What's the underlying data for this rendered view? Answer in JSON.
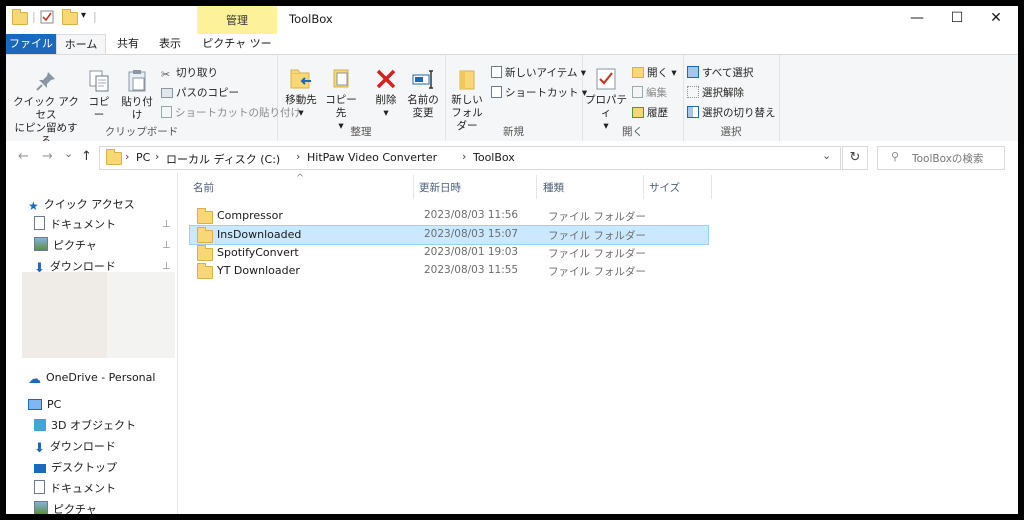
{
  "window": {
    "title": "ToolBox",
    "context_tab_group": "管理",
    "minimize": "—",
    "maximize": "☐",
    "close": "✕"
  },
  "ribbon_tabs": {
    "file": "ファイル",
    "home": "ホーム",
    "share": "共有",
    "view": "表示",
    "picture_tools": "ピクチャ ツール",
    "help": "?",
    "collapse": "⌃"
  },
  "ribbon": {
    "clipboard": {
      "label": "クリップボード",
      "pin_quick_access": [
        "クイック アクセス",
        "にピン留めする"
      ],
      "copy": "コピー",
      "paste": "貼り付け",
      "cut": "切り取り",
      "copy_path": "パスのコピー",
      "paste_shortcut": "ショートカットの貼り付け"
    },
    "organize": {
      "label": "整理",
      "move_to": "移動先",
      "copy_to": "コピー先",
      "delete": "削除",
      "rename": [
        "名前の",
        "変更"
      ]
    },
    "new": {
      "label": "新規",
      "new_folder": [
        "新しい",
        "フォルダー"
      ],
      "new_item": "新しいアイテム ▾",
      "easy_access": "ショートカット ▾"
    },
    "open": {
      "label": "開く",
      "properties": "プロパティ",
      "open": "開く ▾",
      "edit": "編集",
      "history": "履歴"
    },
    "select": {
      "label": "選択",
      "select_all": "すべて選択",
      "select_none": "選択解除",
      "invert": "選択の切り替え"
    }
  },
  "address": {
    "back": "←",
    "forward": "→",
    "recent": "⌄",
    "up": "↑",
    "crumbs": [
      "PC",
      "ローカル ディスク (C:)",
      "HitPaw Video Converter",
      "ToolBox"
    ],
    "dropdown": "⌄",
    "refresh": "↻",
    "search_placeholder": "ToolBoxの検索",
    "search_icon": "⚲"
  },
  "nav": {
    "quick_access": "クイック アクセス",
    "qa_items": [
      "ドキュメント",
      "ピクチャ",
      "ダウンロード"
    ],
    "onedrive": "OneDrive - Personal",
    "pc": "PC",
    "pc_items": [
      "3D オブジェクト",
      "ダウンロード",
      "デスクトップ",
      "ドキュメント",
      "ピクチャ"
    ],
    "pin_glyph": "📌"
  },
  "list": {
    "columns": {
      "name": "名前",
      "date": "更新日時",
      "type": "種類",
      "size": "サイズ"
    },
    "sort_glyph": "^",
    "rows": [
      {
        "name": "Compressor",
        "date": "2023/08/03 11:56",
        "type": "ファイル フォルダー",
        "selected": false
      },
      {
        "name": "InsDownloaded",
        "date": "2023/08/03 15:07",
        "type": "ファイル フォルダー",
        "selected": true
      },
      {
        "name": "SpotifyConvert",
        "date": "2023/08/01 19:03",
        "type": "ファイル フォルダー",
        "selected": false
      },
      {
        "name": "YT Downloader",
        "date": "2023/08/03 11:55",
        "type": "ファイル フォルダー",
        "selected": false
      }
    ]
  },
  "colors": {
    "accent": "#1a69bf",
    "selection": "#cce8ff",
    "context_tab": "#fdf29a",
    "folder": "#f8d775"
  }
}
